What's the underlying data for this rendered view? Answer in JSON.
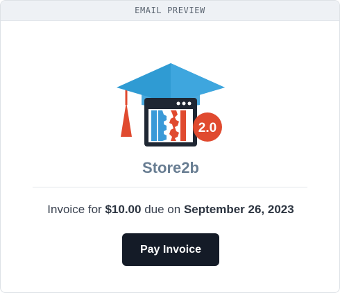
{
  "preview_label": "EMAIL PREVIEW",
  "logo": {
    "badge_text": "2.0",
    "icon": "graduation-cap-store-logo",
    "colors": {
      "cap": "#2f9bd3",
      "cap_band": "#4aa9de",
      "tassel": "#e04a2f",
      "badge": "#e04a2f",
      "frame": "#1f2733",
      "gear_blue": "#3a9ad8",
      "gear_red": "#e04a2f"
    }
  },
  "store_name": "Store2b",
  "invoice": {
    "prefix": "Invoice for",
    "amount": "$10.00",
    "middle": "due on",
    "due_date": "September 26, 2023"
  },
  "pay_button_label": "Pay Invoice",
  "colors": {
    "button_bg": "#141b27",
    "store_name": "#687d92",
    "preview_bar_bg": "#eef1f5"
  }
}
